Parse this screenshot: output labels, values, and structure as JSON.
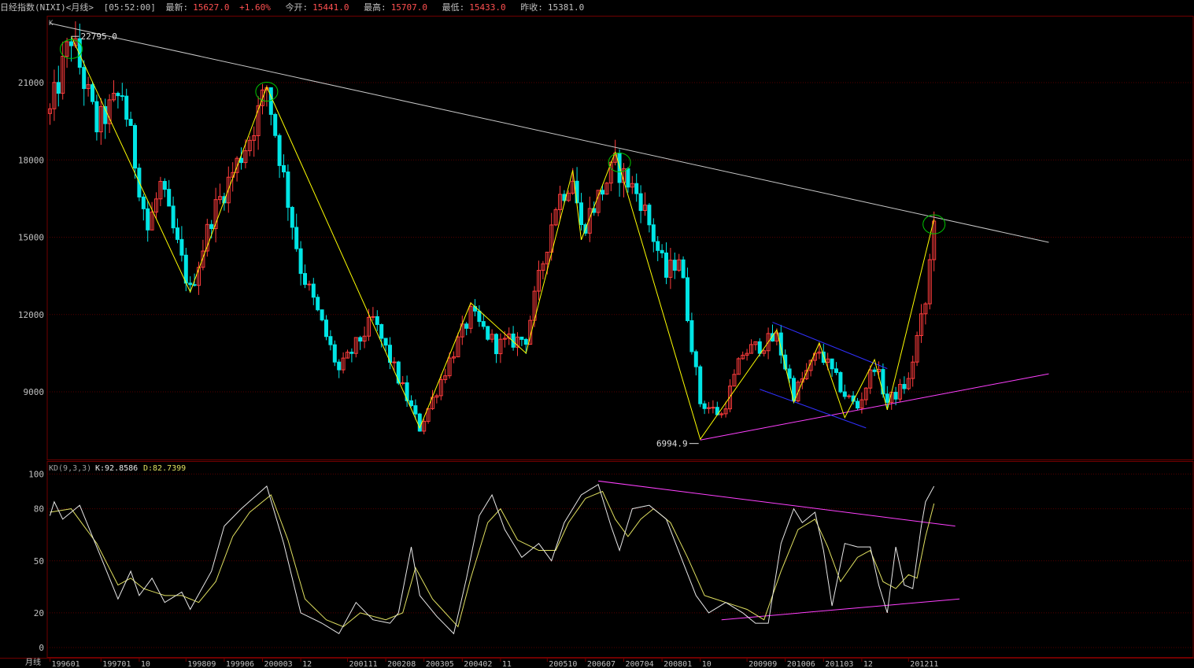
{
  "header": {
    "title": "日经指数(NIXI)<月线>",
    "time": "[05:52:00]",
    "latest_label": "最新:",
    "latest": "15627.0",
    "change": "+1.60%",
    "open_label": "今开:",
    "open": "15441.0",
    "high_label": "最高:",
    "high": "15707.0",
    "low_label": "最低:",
    "low": "15433.0",
    "prev_label": "昨收:",
    "prev": "15381.0"
  },
  "colors": {
    "up": "#ff3c3c",
    "down": "#00e5e5",
    "zigzag": "#ffff00",
    "trend": "#c8c8c8",
    "support": "#ff40ff",
    "channel": "#3030ff",
    "circle": "#00c800",
    "k_line": "#e8e8e8",
    "d_line": "#e0e060",
    "grid": "#550000",
    "frame": "#700000"
  },
  "chart_data": [
    {
      "type": "candlestick",
      "panel": "main",
      "corner_label": "K",
      "period": "月线",
      "ylim": [
        6500,
        23500
      ],
      "y_ticks": [
        21000,
        18000,
        15000,
        12000,
        9000
      ],
      "x_range": [
        199601,
        201311
      ],
      "x_ticks": [
        "199601",
        "199701",
        "10",
        "199809",
        "199906",
        "200003",
        "12",
        "200111",
        "200208",
        "200305",
        "200402",
        "11",
        "200510",
        "200607",
        "200704",
        "200801",
        "10",
        "200909",
        "201006",
        "201103",
        "12",
        "201211"
      ],
      "annotations": [
        {
          "text": "22795.0",
          "x": "1996-06",
          "y": 22795
        },
        {
          "text": "6994.9",
          "x": "2008-10",
          "y": 6994.9
        }
      ],
      "zigzag": [
        {
          "x": "1996-06",
          "y": 22795
        },
        {
          "x": "1998-10",
          "y": 12880
        },
        {
          "x": "2000-04",
          "y": 20830
        },
        {
          "x": "2003-04",
          "y": 7600
        },
        {
          "x": "2004-04",
          "y": 12450
        },
        {
          "x": "2005-05",
          "y": 10500
        },
        {
          "x": "2006-04",
          "y": 17600
        },
        {
          "x": "2006-06",
          "y": 14900
        },
        {
          "x": "2007-02",
          "y": 18300
        },
        {
          "x": "2008-10",
          "y": 7160
        },
        {
          "x": "2010-04",
          "y": 11400
        },
        {
          "x": "2010-08",
          "y": 8600
        },
        {
          "x": "2011-02",
          "y": 10900
        },
        {
          "x": "2011-08",
          "y": 8000
        },
        {
          "x": "2012-03",
          "y": 10250
        },
        {
          "x": "2012-06",
          "y": 8300
        },
        {
          "x": "2013-05",
          "y": 15700
        }
      ],
      "trendlines": [
        {
          "role": "resistance",
          "from": {
            "x": "1996-01",
            "y": 23300
          },
          "to": {
            "x": "2015-08",
            "y": 14800
          }
        },
        {
          "role": "support",
          "from": {
            "x": "2008-10",
            "y": 7130
          },
          "to": {
            "x": "2015-08",
            "y": 9700
          }
        },
        {
          "role": "channel-upper",
          "from": {
            "x": "2010-03",
            "y": 11700
          },
          "to": {
            "x": "2012-06",
            "y": 9900
          }
        },
        {
          "role": "channel-lower",
          "from": {
            "x": "2009-12",
            "y": 9100
          },
          "to": {
            "x": "2012-01",
            "y": 7600
          }
        }
      ],
      "highlights": [
        {
          "x": "1996-06",
          "y": 22300
        },
        {
          "x": "2000-04",
          "y": 20650
        },
        {
          "x": "2007-03",
          "y": 17900
        },
        {
          "x": "2013-05",
          "y": 15500
        }
      ],
      "pivots": [
        [
          "1996-01",
          19800
        ],
        [
          "1996-06",
          22795
        ],
        [
          "1996-12",
          19300
        ],
        [
          "1997-06",
          20600
        ],
        [
          "1997-12",
          15300
        ],
        [
          "1998-03",
          17000
        ],
        [
          "1998-10",
          12880
        ],
        [
          "1999-03",
          15800
        ],
        [
          "1999-12",
          18900
        ],
        [
          "2000-04",
          20830
        ],
        [
          "2000-12",
          13800
        ],
        [
          "2001-03",
          12500
        ],
        [
          "2001-09",
          9800
        ],
        [
          "2002-05",
          11800
        ],
        [
          "2003-04",
          7600
        ],
        [
          "2003-12",
          10600
        ],
        [
          "2004-04",
          12000
        ],
        [
          "2004-10",
          10800
        ],
        [
          "2005-05",
          11100
        ],
        [
          "2005-12",
          16300
        ],
        [
          "2006-04",
          17400
        ],
        [
          "2006-06",
          15300
        ],
        [
          "2007-02",
          17800
        ],
        [
          "2007-08",
          16500
        ],
        [
          "2008-02",
          13500
        ],
        [
          "2008-05",
          14300
        ],
        [
          "2008-10",
          8600
        ],
        [
          "2009-03",
          8100
        ],
        [
          "2009-08",
          10500
        ],
        [
          "2010-04",
          11100
        ],
        [
          "2010-08",
          8900
        ],
        [
          "2011-02",
          10600
        ],
        [
          "2011-08",
          8900
        ],
        [
          "2011-11",
          8400
        ],
        [
          "2012-03",
          10080
        ],
        [
          "2012-06",
          8600
        ],
        [
          "2012-11",
          9400
        ],
        [
          "2013-01",
          11100
        ],
        [
          "2013-03",
          12400
        ],
        [
          "2013-05",
          15627
        ]
      ]
    },
    {
      "type": "line",
      "panel": "indicator",
      "title": "KD(9,3,3)",
      "k_label": "K:92.8586",
      "d_label": "D:82.7399",
      "ylim": [
        0,
        100
      ],
      "y_ticks": [
        100,
        80,
        50,
        20,
        0
      ],
      "k_pivots": [
        [
          "1996-01",
          76
        ],
        [
          "1996-02",
          84
        ],
        [
          "1996-04",
          74
        ],
        [
          "1996-08",
          82
        ],
        [
          "1997-01",
          52
        ],
        [
          "1997-05",
          28
        ],
        [
          "1997-08",
          44
        ],
        [
          "1997-10",
          30
        ],
        [
          "1998-01",
          40
        ],
        [
          "1998-04",
          26
        ],
        [
          "1998-08",
          32
        ],
        [
          "1998-10",
          22
        ],
        [
          "1999-03",
          44
        ],
        [
          "1999-06",
          70
        ],
        [
          "1999-10",
          80
        ],
        [
          "2000-04",
          93
        ],
        [
          "2000-08",
          60
        ],
        [
          "2000-12",
          20
        ],
        [
          "2001-05",
          14
        ],
        [
          "2001-09",
          8
        ],
        [
          "2002-01",
          26
        ],
        [
          "2002-05",
          16
        ],
        [
          "2002-09",
          14
        ],
        [
          "2002-11",
          20
        ],
        [
          "2003-02",
          58
        ],
        [
          "2003-04",
          30
        ],
        [
          "2003-08",
          18
        ],
        [
          "2003-12",
          8
        ],
        [
          "2004-03",
          40
        ],
        [
          "2004-06",
          76
        ],
        [
          "2004-09",
          88
        ],
        [
          "2004-12",
          68
        ],
        [
          "2005-04",
          52
        ],
        [
          "2005-08",
          60
        ],
        [
          "2005-11",
          50
        ],
        [
          "2006-02",
          72
        ],
        [
          "2006-06",
          88
        ],
        [
          "2006-10",
          94
        ],
        [
          "2007-01",
          70
        ],
        [
          "2007-03",
          56
        ],
        [
          "2007-06",
          80
        ],
        [
          "2007-10",
          82
        ],
        [
          "2008-02",
          74
        ],
        [
          "2008-05",
          55
        ],
        [
          "2008-09",
          30
        ],
        [
          "2008-12",
          20
        ],
        [
          "2009-04",
          26
        ],
        [
          "2009-08",
          20
        ],
        [
          "2009-11",
          14
        ],
        [
          "2010-02",
          14
        ],
        [
          "2010-05",
          60
        ],
        [
          "2010-08",
          80
        ],
        [
          "2010-10",
          72
        ],
        [
          "2011-01",
          78
        ],
        [
          "2011-03",
          56
        ],
        [
          "2011-05",
          24
        ],
        [
          "2011-08",
          60
        ],
        [
          "2011-11",
          58
        ],
        [
          "2012-02",
          58
        ],
        [
          "2012-04",
          36
        ],
        [
          "2012-06",
          20
        ],
        [
          "2012-08",
          58
        ],
        [
          "2012-10",
          36
        ],
        [
          "2012-12",
          34
        ],
        [
          "2013-02",
          70
        ],
        [
          "2013-03",
          84
        ],
        [
          "2013-05",
          93
        ]
      ],
      "d_pivots": [
        [
          "1996-01",
          78
        ],
        [
          "1996-06",
          80
        ],
        [
          "1996-12",
          60
        ],
        [
          "1997-05",
          36
        ],
        [
          "1997-08",
          40
        ],
        [
          "1997-11",
          34
        ],
        [
          "1998-04",
          30
        ],
        [
          "1998-08",
          30
        ],
        [
          "1998-12",
          26
        ],
        [
          "1999-04",
          38
        ],
        [
          "1999-08",
          64
        ],
        [
          "1999-12",
          78
        ],
        [
          "2000-05",
          88
        ],
        [
          "2000-09",
          62
        ],
        [
          "2001-01",
          28
        ],
        [
          "2001-06",
          16
        ],
        [
          "2001-10",
          12
        ],
        [
          "2002-02",
          20
        ],
        [
          "2002-08",
          16
        ],
        [
          "2002-12",
          20
        ],
        [
          "2003-03",
          46
        ],
        [
          "2003-07",
          28
        ],
        [
          "2004-01",
          12
        ],
        [
          "2004-04",
          40
        ],
        [
          "2004-08",
          72
        ],
        [
          "2004-11",
          80
        ],
        [
          "2005-03",
          62
        ],
        [
          "2005-08",
          56
        ],
        [
          "2005-12",
          56
        ],
        [
          "2006-03",
          72
        ],
        [
          "2006-07",
          86
        ],
        [
          "2006-11",
          90
        ],
        [
          "2007-02",
          74
        ],
        [
          "2007-05",
          64
        ],
        [
          "2007-08",
          74
        ],
        [
          "2007-11",
          80
        ],
        [
          "2008-03",
          72
        ],
        [
          "2008-07",
          52
        ],
        [
          "2008-11",
          30
        ],
        [
          "2009-04",
          26
        ],
        [
          "2009-09",
          22
        ],
        [
          "2010-01",
          16
        ],
        [
          "2010-05",
          44
        ],
        [
          "2010-09",
          68
        ],
        [
          "2011-01",
          74
        ],
        [
          "2011-04",
          58
        ],
        [
          "2011-07",
          38
        ],
        [
          "2011-11",
          52
        ],
        [
          "2012-02",
          56
        ],
        [
          "2012-05",
          38
        ],
        [
          "2012-08",
          34
        ],
        [
          "2012-11",
          42
        ],
        [
          "2013-01",
          40
        ],
        [
          "2013-03",
          64
        ],
        [
          "2013-05",
          83
        ]
      ],
      "trendlines": [
        {
          "from": {
            "x": "2006-10",
            "y": 96
          },
          "to": {
            "x": "2013-10",
            "y": 70
          }
        },
        {
          "from": {
            "x": "2009-03",
            "y": 16
          },
          "to": {
            "x": "2013-11",
            "y": 28
          }
        }
      ]
    }
  ]
}
